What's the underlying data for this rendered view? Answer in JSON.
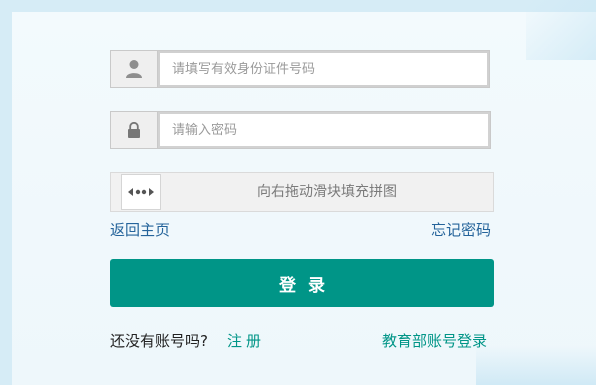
{
  "form": {
    "id_placeholder": "请填写有效身份证件号码",
    "password_placeholder": "请输入密码",
    "slider_text": "向右拖动滑块填充拼图",
    "back_home": "返回主页",
    "forgot_password": "忘记密码",
    "login_label": "登录",
    "no_account": "还没有账号吗?",
    "register": "注册",
    "moe_login": "教育部账号登录"
  },
  "colors": {
    "primary": "#009587",
    "link": "#25649b"
  },
  "icons": {
    "user": "user-icon",
    "lock": "lock-icon",
    "slider": "slider-arrows-icon"
  }
}
